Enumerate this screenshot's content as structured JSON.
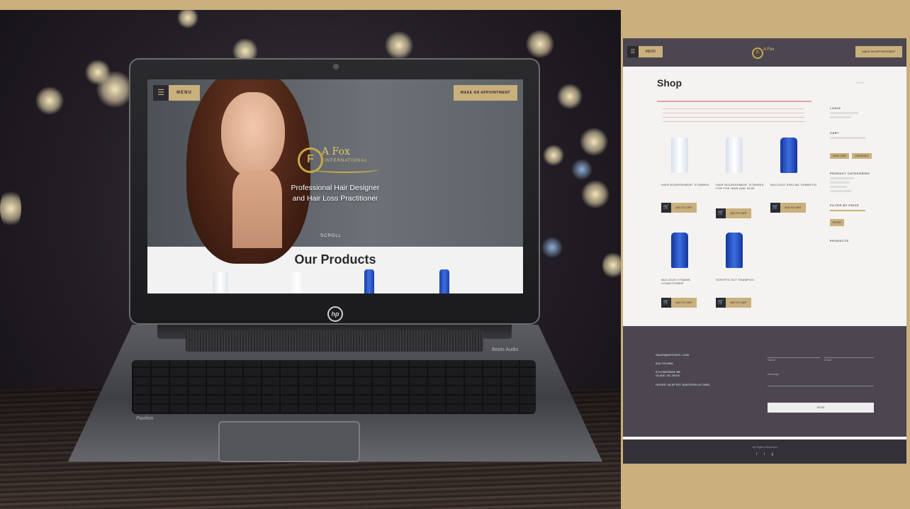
{
  "laptop": {
    "menu_label": "MENU",
    "appointment_label": "MAKE AN APPOINTMENT",
    "logo_name": "A Fox",
    "logo_sub": "INTERNATIONAL",
    "tagline_line1": "Professional Hair Designer",
    "tagline_line2": "and Hair Loss Practitioner",
    "scroll_label": "SCROLL",
    "products_title": "Our Products",
    "brand_badge": "hp",
    "model_label": "Pavilion",
    "base_brand": "Beats Audio"
  },
  "shop_page": {
    "menu_label": "MENU",
    "appointment_label": "MAKE AN APPOINTMENT",
    "logo_name": "A Fox",
    "title": "Shop",
    "products": [
      {
        "name": "HAIR NOURISHMENT VITAMINS",
        "cart_label": "ADD TO CART"
      },
      {
        "name": "HAIR NOURISHMENT VITAMINS FOR THE HAIR AND SKIN",
        "cart_label": "ADD TO CART"
      },
      {
        "name": "NUCLEUS SPECIAL SHAMPOO",
        "cart_label": "ADD TO CART"
      },
      {
        "name": "NUCLEUS VITAMIN CONDITIONER",
        "cart_label": "ADD TO CART"
      },
      {
        "name": "SCRIPTS GUT SHAMPOO",
        "cart_label": "ADD TO CART"
      }
    ],
    "sidebar": {
      "login": "LOGIN",
      "cart": "CART",
      "view_cart": "VIEW CART",
      "checkout": "CHECKOUT",
      "categories": "PRODUCT CATEGORIES",
      "filter": "FILTER BY PRICE",
      "filter_btn": "FILTER",
      "products": "PRODUCTS"
    },
    "footer": {
      "email": "SALES@AFOXINTL.COM",
      "phone": "818-733-4961",
      "address_line1": "6714 BEMINDE BB",
      "address_line2": "GLADE, NC 28105",
      "hours": "HOURS: 9A-5P EST (EASTERN US TIME)",
      "name_placeholder": "Name",
      "email_placeholder": "Email",
      "message_placeholder": "Message",
      "send_label": "SEND",
      "copyright": "All Rights Reserved",
      "social": "f  t  g"
    }
  }
}
